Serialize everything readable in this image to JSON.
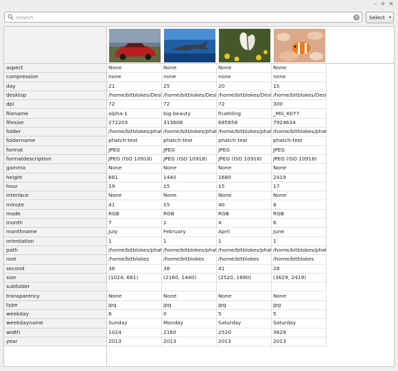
{
  "search": {
    "placeholder": "Search",
    "value": ""
  },
  "select_button": {
    "label": "Select"
  },
  "window_controls": [
    "–",
    "+",
    "×"
  ],
  "images": [
    {
      "name": "alpha-1",
      "thumb": "red vintage car on road"
    },
    {
      "name": "big-beauty",
      "thumb": "shark underwater"
    },
    {
      "name": "fruehling",
      "thumb": "butterfly on yellow flowers"
    },
    {
      "name": "_MG_6077",
      "thumb": "clownfish in anemone"
    }
  ],
  "rows": [
    {
      "field": "aspect",
      "values": [
        "None",
        "None",
        "None",
        "None"
      ]
    },
    {
      "field": "compression",
      "values": [
        "none",
        "none",
        "none",
        "none"
      ]
    },
    {
      "field": "day",
      "values": [
        "21",
        "25",
        "20",
        "15"
      ]
    },
    {
      "field": "desktop",
      "values": [
        "/home/bitblokes/Desktop",
        "/home/bitblokes/Desktop",
        "/home/bitblokes/Desktop",
        "/home/bitblokes/Desktop"
      ]
    },
    {
      "field": "dpi",
      "values": [
        "72",
        "72",
        "72",
        "300"
      ]
    },
    {
      "field": "filename",
      "values": [
        "alpha-1",
        "big-beauty",
        "fruehling",
        "_MG_6077"
      ]
    },
    {
      "field": "filesize",
      "values": [
        "272203",
        "313608",
        "685658",
        "7924634"
      ]
    },
    {
      "field": "folder",
      "values": [
        "/home/bitblokes/phatch-test",
        "/home/bitblokes/phatch-test",
        "/home/bitblokes/phatch-test",
        "/home/bitblokes/phatch-test"
      ]
    },
    {
      "field": "foldername",
      "values": [
        "phatch-test",
        "phatch-test",
        "phatch-test",
        "phatch-test"
      ]
    },
    {
      "field": "format",
      "values": [
        "JPEG",
        "JPEG",
        "JPEG",
        "JPEG"
      ]
    },
    {
      "field": "formatdescription",
      "values": [
        "JPEG (ISO 10918)",
        "JPEG (ISO 10918)",
        "JPEG (ISO 10918)",
        "JPEG (ISO 10918)"
      ]
    },
    {
      "field": "gamma",
      "values": [
        "None",
        "None",
        "None",
        "None"
      ]
    },
    {
      "field": "height",
      "values": [
        "681",
        "1440",
        "1680",
        "2419"
      ]
    },
    {
      "field": "hour",
      "values": [
        "19",
        "15",
        "15",
        "17"
      ]
    },
    {
      "field": "interlace",
      "values": [
        "None",
        "None",
        "None",
        "None"
      ]
    },
    {
      "field": "minute",
      "values": [
        "41",
        "15",
        "40",
        "8"
      ]
    },
    {
      "field": "mode",
      "values": [
        "RGB",
        "RGB",
        "RGB",
        "RGB"
      ]
    },
    {
      "field": "month",
      "values": [
        "7",
        "2",
        "4",
        "6"
      ]
    },
    {
      "field": "monthname",
      "values": [
        "July",
        "February",
        "April",
        "June"
      ]
    },
    {
      "field": "orientation",
      "values": [
        "1",
        "1",
        "1",
        "1"
      ]
    },
    {
      "field": "path",
      "values": [
        "/home/bitblokes/phatch-test",
        "/home/bitblokes/phatch-test",
        "/home/bitblokes/phatch-test",
        "/home/bitblokes/phatch-test"
      ]
    },
    {
      "field": "root",
      "values": [
        "/home/bitblokes",
        "/home/bitblokes",
        "/home/bitblokes",
        "/home/bitblokes"
      ]
    },
    {
      "field": "second",
      "values": [
        "36",
        "38",
        "41",
        "28"
      ]
    },
    {
      "field": "size",
      "values": [
        "(1024, 681)",
        "(2160, 1440)",
        "(2520, 1680)",
        "(3629, 2419)"
      ]
    },
    {
      "field": "subfolder",
      "values": [
        "",
        "",
        "",
        ""
      ]
    },
    {
      "field": "transparency",
      "values": [
        "None",
        "None",
        "None",
        "None"
      ]
    },
    {
      "field": "type",
      "values": [
        "jpg",
        "jpg",
        "jpg",
        "jpg"
      ]
    },
    {
      "field": "weekday",
      "values": [
        "6",
        "0",
        "5",
        "5"
      ]
    },
    {
      "field": "weekdayname",
      "values": [
        "Sunday",
        "Monday",
        "Saturday",
        "Saturday"
      ]
    },
    {
      "field": "width",
      "values": [
        "1024",
        "2160",
        "2520",
        "3629"
      ]
    },
    {
      "field": "year",
      "values": [
        "2013",
        "2013",
        "2013",
        "2013"
      ]
    }
  ]
}
